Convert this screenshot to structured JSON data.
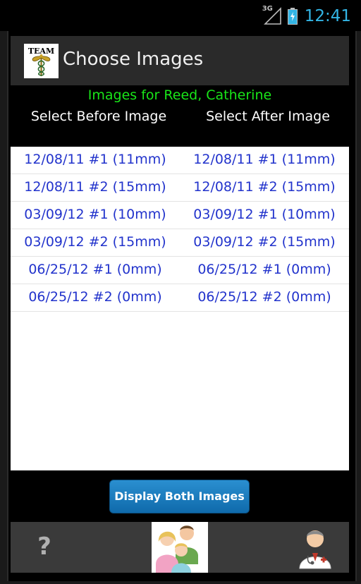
{
  "status_bar": {
    "network_label": "3G",
    "time": "12:41"
  },
  "action_bar": {
    "logo_text": "TEAM",
    "title": "Choose Images"
  },
  "patient_heading": "Images for Reed, Catherine",
  "columns": {
    "before_header": "Select Before Image",
    "after_header": "Select After Image"
  },
  "rows": [
    {
      "before": "12/08/11 #1 (11mm)",
      "after": "12/08/11 #1 (11mm)"
    },
    {
      "before": "12/08/11 #2 (15mm)",
      "after": "12/08/11 #2 (15mm)"
    },
    {
      "before": "03/09/12 #1 (10mm)",
      "after": "03/09/12 #1 (10mm)"
    },
    {
      "before": "03/09/12 #2 (15mm)",
      "after": "03/09/12 #2 (15mm)"
    },
    {
      "before": "06/25/12 #1 (0mm)",
      "after": "06/25/12 #1 (0mm)"
    },
    {
      "before": "06/25/12 #2 (0mm)",
      "after": "06/25/12 #2 (0mm)"
    }
  ],
  "display_button_label": "Display Both Images",
  "bottom_bar": {
    "help_label": "?",
    "family_icon": "family-icon",
    "doctor_icon": "doctor-icon"
  },
  "colors": {
    "accent_blue": "#33b5e5",
    "patient_green": "#19e619",
    "link_blue": "#2233cc",
    "button_blue": "#1a7cc0"
  }
}
